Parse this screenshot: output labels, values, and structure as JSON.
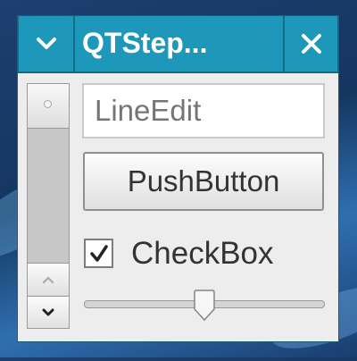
{
  "window": {
    "title": "QTStep...",
    "menu_icon": "chevron-down-icon",
    "close_icon": "close-icon"
  },
  "line_edit": {
    "placeholder": "LineEdit",
    "value": ""
  },
  "push_button": {
    "label": "PushButton"
  },
  "checkbox": {
    "label": "CheckBox",
    "checked": true
  },
  "slider": {
    "value_fraction": 0.5
  },
  "scrollbar": {
    "orientation": "vertical"
  },
  "colors": {
    "titlebar": "#1d98bb",
    "window_bg": "#ededed",
    "desktop": "#1d3f72"
  }
}
